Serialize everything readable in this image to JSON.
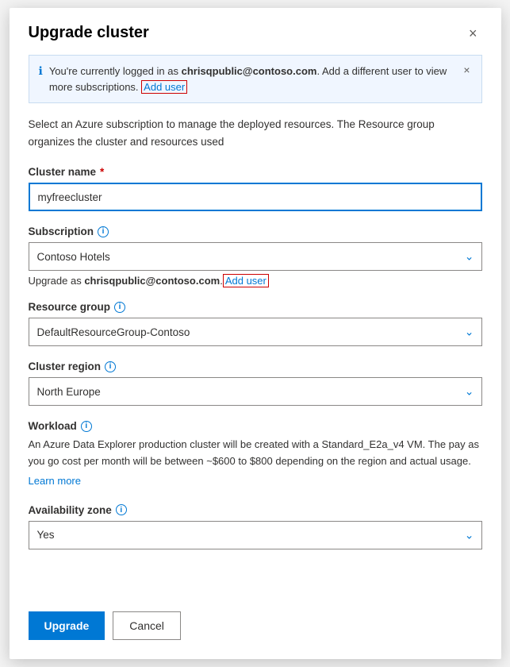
{
  "dialog": {
    "title": "Upgrade cluster",
    "close_label": "×"
  },
  "info_banner": {
    "text_before": "You're currently logged in as ",
    "email": "chrisqpublic@contoso.com",
    "text_after": ". Add a different user to view more subscriptions.",
    "add_user_label": "Add user"
  },
  "description": "Select an Azure subscription to manage the deployed resources. The Resource group organizes the cluster and resources used",
  "form": {
    "cluster_name_label": "Cluster name",
    "cluster_name_required": "*",
    "cluster_name_value": "myfreecluster",
    "subscription_label": "Subscription",
    "subscription_value": "Contoso Hotels",
    "subscription_subtext_before": "Upgrade as ",
    "subscription_subtext_email": "chrisqpublic@contoso.com",
    "subscription_subtext_add_user": "Add user",
    "resource_group_label": "Resource group",
    "resource_group_value": "DefaultResourceGroup-Contoso",
    "cluster_region_label": "Cluster region",
    "cluster_region_value": "North Europe",
    "workload_label": "Workload",
    "workload_description": "An Azure Data Explorer production cluster will be created with a Standard_E2a_v4 VM. The pay as you go cost per month will be between ~$600 to $800 depending on the region and actual usage.",
    "workload_learn_more": "Learn more",
    "availability_zone_label": "Availability zone",
    "availability_zone_value": "Yes"
  },
  "footer": {
    "upgrade_label": "Upgrade",
    "cancel_label": "Cancel"
  }
}
